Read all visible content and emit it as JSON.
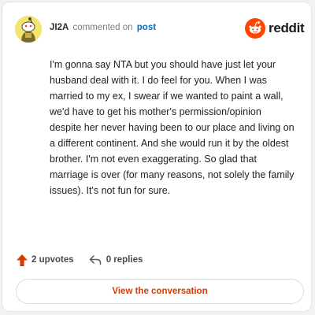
{
  "header": {
    "username": "JI2A",
    "verb": "commented on",
    "post_link": "post",
    "brand": "reddit"
  },
  "icons": {
    "avatar": "snoo-avatar-icon",
    "brand": "reddit-logo-icon",
    "upvote": "upvote-arrow-icon",
    "reply": "reply-arrow-icon"
  },
  "comment": {
    "text": "I'm gonna say NTA but you should have just let your husband deal with it. I do feel for you. When I was married to my ex, I swear if we wanted to paint a wall, we'd have to get his mother's permission/opinion despite her never having been to our place and living on a different continent. And she would run it by the oldest brother. I'm not even exaggerating. So glad that marriage is over (for many reasons, not solely the family issues). It's not fun for sure."
  },
  "actions": {
    "upvotes": "2 upvotes",
    "replies": "0 replies"
  },
  "cta": {
    "label": "View the conversation"
  },
  "colors": {
    "brand_orange": "#ff4500",
    "upvote": "#d93a00",
    "link": "#0b6fb8",
    "avatar_bg": "#f4e56e"
  }
}
